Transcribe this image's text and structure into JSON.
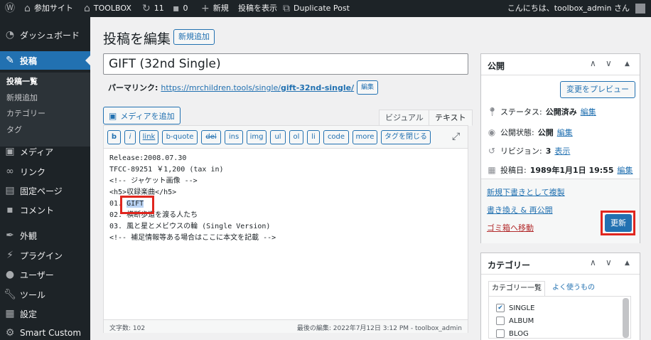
{
  "adminbar": {
    "site_name": "参加サイト",
    "toolbox": "TOOLBOX",
    "updates_count": "11",
    "comments_count": "0",
    "new_label": "新規",
    "view_post": "投稿を表示",
    "duplicate_post": "Duplicate Post",
    "greeting": "こんにちは、toolbox_admin さん"
  },
  "sidebar": {
    "items": [
      {
        "label": "ダッシュボード",
        "icon": "dashboard-icon"
      },
      {
        "label": "投稿",
        "icon": "pushpin-icon"
      },
      {
        "label": "メディア",
        "icon": "media-icon"
      },
      {
        "label": "リンク",
        "icon": "link-icon"
      },
      {
        "label": "固定ページ",
        "icon": "page-icon"
      },
      {
        "label": "コメント",
        "icon": "comment-icon"
      },
      {
        "label": "外観",
        "icon": "appearance-icon"
      },
      {
        "label": "プラグイン",
        "icon": "plugin-icon"
      },
      {
        "label": "ユーザー",
        "icon": "user-icon"
      },
      {
        "label": "ツール",
        "icon": "wrench-icon"
      },
      {
        "label": "設定",
        "icon": "settings-icon"
      },
      {
        "label": "Smart Custom",
        "icon": "gear-icon"
      }
    ],
    "submenu": [
      "投稿一覧",
      "新規追加",
      "カテゴリー",
      "タグ"
    ]
  },
  "main": {
    "page_title": "投稿を編集",
    "add_new": "新規追加",
    "post_title": "GIFT (32nd Single)",
    "permalink_label": "パーマリンク:",
    "permalink_url": "https://mrchildren.tools/single/",
    "permalink_slug": "gift-32nd-single/",
    "edit_btn": "編集",
    "media_btn": "メディアを追加",
    "tab_visual": "ビジュアル",
    "tab_text": "テキスト",
    "quicktags": [
      "b",
      "i",
      "link",
      "b-quote",
      "del",
      "ins",
      "img",
      "ul",
      "ol",
      "li",
      "code",
      "more",
      "タグを閉じる"
    ],
    "content_lines": [
      "Release:2008.07.30",
      "TFCC-89251 ￥1,200 (tax in)",
      "<!-- ジャケット画像 -->",
      "<h5>収録楽曲</h5>",
      "01. ",
      "02. 横断歩道を渡る人たち",
      "03. 風と星とメビウスの輪 (Single Version)",
      "<!-- 補足情報等ある場合はここに本文を記載 -->"
    ],
    "selected_text": "GIFT",
    "word_count": "文字数: 102",
    "last_edit": "最後の編集: 2022年7月12日 3:12 PM - toolbox_admin"
  },
  "publish": {
    "title": "公開",
    "preview_btn": "変更をプレビュー",
    "status_label": "ステータス:",
    "status_value": "公開済み",
    "visibility_label": "公開状態:",
    "visibility_value": "公開",
    "revisions_label": "リビジョン:",
    "revisions_value": "3",
    "revisions_link": "表示",
    "date_label": "投稿日:",
    "date_value": "1989年1月1日 19:55",
    "edit_link": "編集",
    "copy_draft": "新規下書きとして複製",
    "rewrite": "書き換え & 再公開",
    "trash": "ゴミ箱へ移動",
    "update_btn": "更新"
  },
  "categories": {
    "title": "カテゴリー",
    "tab_all": "カテゴリー一覧",
    "tab_popular": "よく使うもの",
    "items": [
      {
        "label": "SINGLE",
        "checked": true
      },
      {
        "label": "ALBUM",
        "checked": false
      },
      {
        "label": "BLOG",
        "checked": false
      }
    ]
  }
}
